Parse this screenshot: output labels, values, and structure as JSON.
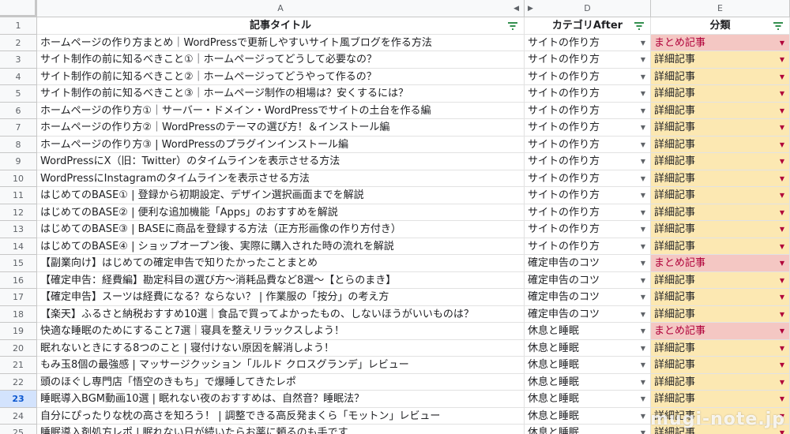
{
  "column_letters": [
    "A",
    "D",
    "E"
  ],
  "header": {
    "title": "記事タイトル",
    "category": "カテゴリAfter",
    "type": "分類"
  },
  "colors": {
    "summary": "#f4c7c3",
    "detail": "#fce8b2",
    "summary_text": "#b0003a"
  },
  "selected_row": 23,
  "rows": [
    {
      "n": "2",
      "title": "ホームページの作り方まとめ｜WordPressで更新しやすいサイト風ブログを作る方法",
      "cat": "サイトの作り方",
      "type": "まとめ記事",
      "kind": "summary"
    },
    {
      "n": "3",
      "title": "サイト制作の前に知るべきこと①｜ホームページってどうして必要なの？",
      "cat": "サイトの作り方",
      "type": "詳細記事",
      "kind": "detail"
    },
    {
      "n": "4",
      "title": "サイト制作の前に知るべきこと②｜ホームページってどうやって作るの？",
      "cat": "サイトの作り方",
      "type": "詳細記事",
      "kind": "detail"
    },
    {
      "n": "5",
      "title": "サイト制作の前に知るべきこと③｜ホームページ制作の相場は？安くするには？",
      "cat": "サイトの作り方",
      "type": "詳細記事",
      "kind": "detail"
    },
    {
      "n": "6",
      "title": "ホームページの作り方①｜サーバー・ドメイン・WordPressでサイトの土台を作る編",
      "cat": "サイトの作り方",
      "type": "詳細記事",
      "kind": "detail"
    },
    {
      "n": "7",
      "title": "ホームページの作り方②｜WordPressのテーマの選び方！＆インストール編",
      "cat": "サイトの作り方",
      "type": "詳細記事",
      "kind": "detail"
    },
    {
      "n": "8",
      "title": "ホームページの作り方③ | WordPressのプラグインインストール編",
      "cat": "サイトの作り方",
      "type": "詳細記事",
      "kind": "detail"
    },
    {
      "n": "9",
      "title": "WordPressにX（旧：Twitter）のタイムラインを表示させる方法",
      "cat": "サイトの作り方",
      "type": "詳細記事",
      "kind": "detail"
    },
    {
      "n": "10",
      "title": "WordPressにInstagramのタイムラインを表示させる方法",
      "cat": "サイトの作り方",
      "type": "詳細記事",
      "kind": "detail"
    },
    {
      "n": "11",
      "title": "はじめてのBASE① | 登録から初期設定、デザイン選択画面までを解説",
      "cat": "サイトの作り方",
      "type": "詳細記事",
      "kind": "detail"
    },
    {
      "n": "12",
      "title": "はじめてのBASE② | 便利な追加機能「Apps」のおすすめを解説",
      "cat": "サイトの作り方",
      "type": "詳細記事",
      "kind": "detail"
    },
    {
      "n": "13",
      "title": "はじめてのBASE③ | BASEに商品を登録する方法（正方形画像の作り方付き）",
      "cat": "サイトの作り方",
      "type": "詳細記事",
      "kind": "detail"
    },
    {
      "n": "14",
      "title": "はじめてのBASE④ | ショップオープン後、実際に購入された時の流れを解説",
      "cat": "サイトの作り方",
      "type": "詳細記事",
      "kind": "detail"
    },
    {
      "n": "15",
      "title": "【副業向け】はじめての確定申告で知りたかったことまとめ",
      "cat": "確定申告のコツ",
      "type": "まとめ記事",
      "kind": "summary"
    },
    {
      "n": "16",
      "title": "【確定申告：経費編】勘定科目の選び方〜消耗品費など8選〜【とらのまき】",
      "cat": "確定申告のコツ",
      "type": "詳細記事",
      "kind": "detail"
    },
    {
      "n": "17",
      "title": "【確定申告】スーツは経費になる？ならない？ | 作業服の「按分」の考え方",
      "cat": "確定申告のコツ",
      "type": "詳細記事",
      "kind": "detail"
    },
    {
      "n": "18",
      "title": "【楽天】ふるさと納税おすすめ10選｜食品で買ってよかったもの、しないほうがいいものは？",
      "cat": "確定申告のコツ",
      "type": "詳細記事",
      "kind": "detail"
    },
    {
      "n": "19",
      "title": "快適な睡眠のためにすること7選｜寝具を整えリラックスしよう！",
      "cat": "休息と睡眠",
      "type": "まとめ記事",
      "kind": "summary"
    },
    {
      "n": "20",
      "title": "眠れないときにする8つのこと | 寝付けない原因を解消しよう！",
      "cat": "休息と睡眠",
      "type": "詳細記事",
      "kind": "detail"
    },
    {
      "n": "21",
      "title": "もみ玉8個の最強感 | マッサージクッション「ルルド クロスグランデ」レビュー",
      "cat": "休息と睡眠",
      "type": "詳細記事",
      "kind": "detail"
    },
    {
      "n": "22",
      "title": "頭のほぐし専門店「悟空のきもち」で爆睡してきたレポ",
      "cat": "休息と睡眠",
      "type": "詳細記事",
      "kind": "detail"
    },
    {
      "n": "23",
      "title": "睡眠導入BGM動画10選 | 眠れない夜のおすすめは、自然音？睡眠法？",
      "cat": "休息と睡眠",
      "type": "詳細記事",
      "kind": "detail"
    },
    {
      "n": "24",
      "title": "自分にぴったりな枕の高さを知ろう！ | 調整できる高反発まくら「モットン」レビュー",
      "cat": "休息と睡眠",
      "type": "詳細記事",
      "kind": "detail"
    },
    {
      "n": "25",
      "title": "睡眠導入剤処方レポ | 眠れない日が続いたらお薬に頼るのも手です",
      "cat": "休息と睡眠",
      "type": "詳細記事",
      "kind": "detail"
    }
  ],
  "watermark": "mugi-note.jp"
}
